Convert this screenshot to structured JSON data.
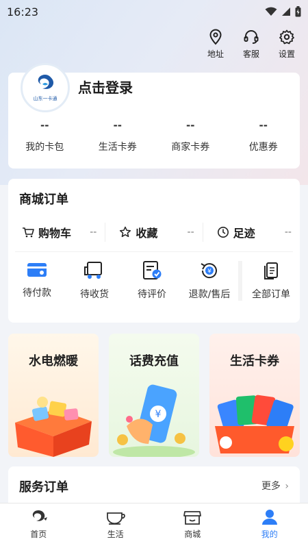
{
  "status_bar": {
    "time": "16:23"
  },
  "top_actions": [
    {
      "label": "地址",
      "icon": "location-pin-icon"
    },
    {
      "label": "客服",
      "icon": "headset-icon"
    },
    {
      "label": "设置",
      "icon": "gear-icon"
    }
  ],
  "profile": {
    "logo_text": "山东一卡通",
    "login_label": "点击登录",
    "stats": [
      {
        "value": "--",
        "label": "我的卡包"
      },
      {
        "value": "--",
        "label": "生活卡券"
      },
      {
        "value": "--",
        "label": "商家卡券"
      },
      {
        "value": "--",
        "label": "优惠券"
      }
    ]
  },
  "mall_orders": {
    "title": "商城订单",
    "quick": [
      {
        "label": "购物车",
        "value": "--",
        "icon": "cart-icon"
      },
      {
        "label": "收藏",
        "value": "--",
        "icon": "star-icon"
      },
      {
        "label": "足迹",
        "value": "--",
        "icon": "clock-icon"
      }
    ],
    "states": [
      {
        "label": "待付款",
        "icon": "card-payment-icon"
      },
      {
        "label": "待收货",
        "icon": "truck-icon"
      },
      {
        "label": "待评价",
        "icon": "review-icon"
      },
      {
        "label": "退款/售后",
        "icon": "refund-icon"
      },
      {
        "label": "全部订单",
        "icon": "documents-icon"
      }
    ]
  },
  "promos": [
    {
      "title": "水电燃暖"
    },
    {
      "title": "话费充值"
    },
    {
      "title": "生活卡券"
    }
  ],
  "service_orders": {
    "title": "服务订单",
    "more_label": "更多"
  },
  "tabbar": [
    {
      "label": "首页",
      "icon": "home-logo-icon",
      "active": false
    },
    {
      "label": "生活",
      "icon": "cup-icon",
      "active": false
    },
    {
      "label": "商城",
      "icon": "store-icon",
      "active": false
    },
    {
      "label": "我的",
      "icon": "person-icon",
      "active": true
    }
  ],
  "colors": {
    "accent": "#2d7ef7",
    "icon_blue": "#2d7ef7"
  }
}
